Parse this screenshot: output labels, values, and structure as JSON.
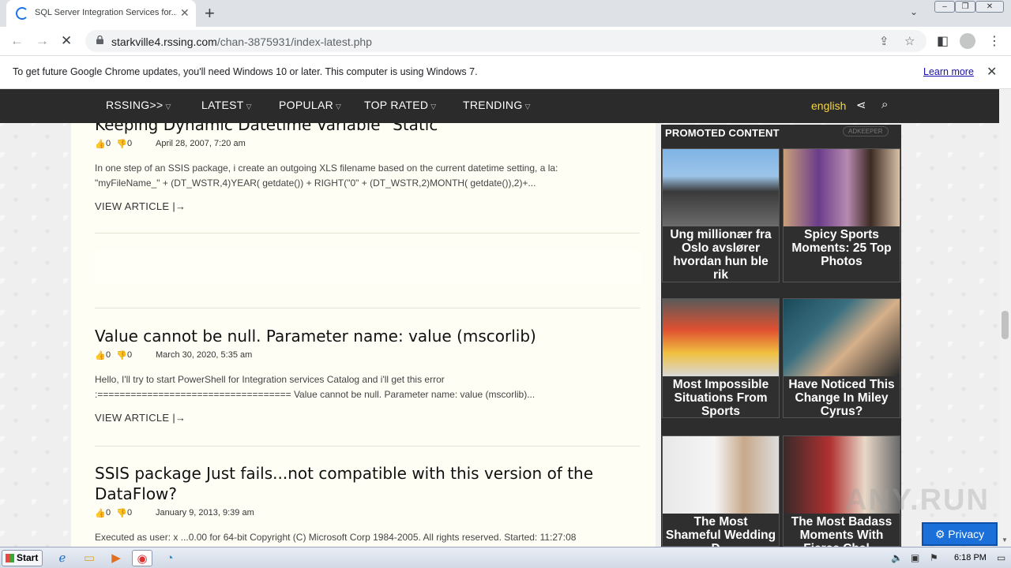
{
  "browser": {
    "tab_title": "SQL Server Integration Services for...",
    "url_host": "starkville4.rssing.com",
    "url_path": "/chan-3875931/index-latest.php",
    "info_message": "To get future Google Chrome updates, you'll need Windows 10 or later. This computer is using Windows 7.",
    "learn_more": "Learn more"
  },
  "site_nav": {
    "items": [
      "RSSING>>",
      "LATEST",
      "POPULAR",
      "TOP RATED",
      "TRENDING"
    ],
    "language": "english"
  },
  "articles": [
    {
      "title": "Keeping Dynamic Datetime Variable \"Static\"",
      "likes": "0",
      "dislikes": "0",
      "date": "April 28, 2007, 7:20 am",
      "excerpt": "In one step of an SSIS package, i create an outgoing XLS filename based on the current datetime setting, a la: \"myFileName_\" + (DT_WSTR,4)YEAR( getdate()) + RIGHT(\"0\" + (DT_WSTR,2)MONTH( getdate()),2)+...",
      "view_label": "VIEW ARTICLE"
    },
    {
      "title": "Value cannot be null. Parameter name: value (mscorlib)",
      "likes": "0",
      "dislikes": "0",
      "date": "March 30, 2020, 5:35 am",
      "excerpt": "Hello,   I'll try to start PowerShell for Integration services Catalog and i'll get this error :=================================== Value cannot be null. Parameter name: value (mscorlib)...",
      "view_label": "VIEW ARTICLE"
    },
    {
      "title": "SSIS package Just fails...not compatible with this version of the DataFlow?",
      "likes": "0",
      "dislikes": "0",
      "date": "January 9, 2013, 9:39 am",
      "excerpt": "Executed as user: x ...0.00 for 64-bit  Copyright (C) Microsoft Corp 1984-2005. All rights reserved.    Started:  11:27:08",
      "view_label": ""
    }
  ],
  "promoted": {
    "title": "PROMOTED CONTENT",
    "badge": "ADKEEPER",
    "cards": [
      {
        "caption": "Ung millionær fra Oslo avslører hvordan hun ble rik"
      },
      {
        "caption": "Spicy Sports Moments: 25 Top Photos"
      },
      {
        "caption": "Most Impossible Situations From Sports"
      },
      {
        "caption": "Have Noticed This Change In Miley Cyrus?"
      },
      {
        "caption": "The Most Shameful Wedding D..."
      },
      {
        "caption": "The Most Badass Moments With Fierce Chal..."
      }
    ]
  },
  "privacy_button": "Privacy",
  "watermark": "ANY.RUN",
  "taskbar": {
    "start_label": "Start",
    "clock": "6:18 PM"
  },
  "colors": {
    "nav_bg": "#2b2b2b",
    "language_accent": "#f5d547",
    "content_bg": "#fffef5",
    "privacy_bg": "#1a6fd8"
  }
}
